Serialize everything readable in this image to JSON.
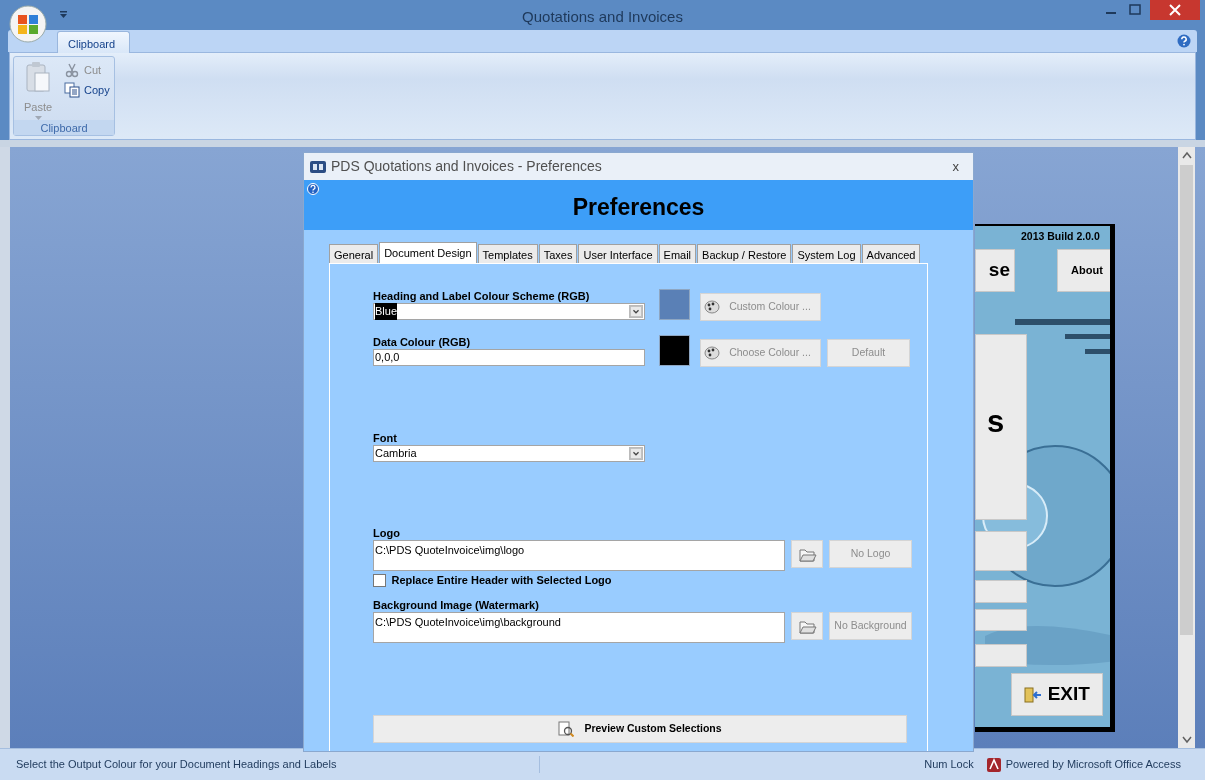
{
  "window": {
    "title": "Quotations and Invoices"
  },
  "ribbon": {
    "tabs": [
      {
        "label": "Clipboard",
        "selected": true
      }
    ],
    "groups": [
      {
        "label": "Clipboard",
        "commands": [
          {
            "label": "Paste",
            "kind": "large",
            "disabled": true
          },
          {
            "label": "Cut",
            "kind": "cut",
            "disabled": true
          },
          {
            "label": "Copy",
            "kind": "copy",
            "disabled": false
          }
        ]
      }
    ]
  },
  "background_form": {
    "version": "2013 Build 2.0.0",
    "top_buttons": [
      "se",
      "About"
    ],
    "big_text": "s",
    "exit_button": "EXIT"
  },
  "dialog": {
    "title": "PDS Quotations and Invoices - Preferences",
    "close": "x",
    "heading": "Preferences",
    "tabs": [
      {
        "label": "General",
        "selected": false
      },
      {
        "label": "Document Design",
        "selected": true
      },
      {
        "label": "Templates",
        "selected": false
      },
      {
        "label": "Taxes",
        "selected": false
      },
      {
        "label": "User Interface",
        "selected": false
      },
      {
        "label": "Email",
        "selected": false
      },
      {
        "label": "Backup / Restore",
        "selected": false
      },
      {
        "label": "System Log",
        "selected": false
      },
      {
        "label": "Advanced",
        "selected": false
      }
    ],
    "fields": [
      {
        "kind": "dropdown",
        "label": "Heading and Label Colour Scheme (RGB)",
        "value": "Blue",
        "highlighted": true,
        "color": "#5a80b6",
        "buttons": [
          {
            "label": "Custom Colour ...",
            "kind": "colour",
            "disabled": true
          }
        ]
      },
      {
        "kind": "text",
        "label": "Data Colour (RGB)",
        "value": "0,0,0",
        "color": "#000000",
        "buttons": [
          {
            "label": "Choose Colour ...",
            "kind": "colour",
            "disabled": true
          },
          {
            "label": "Default",
            "kind": "plain",
            "disabled": true
          }
        ]
      },
      {
        "kind": "dropdown",
        "label": "Font",
        "value": "Cambria",
        "highlighted": false
      },
      {
        "kind": "path",
        "label": "Logo",
        "value": "C:\\PDS QuoteInvoice\\img\\logo",
        "buttons": [
          {
            "label": "No Logo",
            "kind": "plain",
            "disabled": true
          }
        ],
        "checkbox": {
          "label": "Replace Entire Header with Selected Logo",
          "checked": false
        }
      },
      {
        "kind": "path",
        "label": "Background Image (Watermark)",
        "value": "C:\\PDS QuoteInvoice\\img\\background",
        "buttons": [
          {
            "label": "No Background",
            "kind": "plain",
            "disabled": true
          }
        ]
      }
    ],
    "preview_button": "Preview Custom Selections"
  },
  "status_bar": {
    "message": "Select the Output Colour for your Document Headings and Labels",
    "num_lock": "Num Lock",
    "powered_by": "Powered by Microsoft Office Access"
  }
}
